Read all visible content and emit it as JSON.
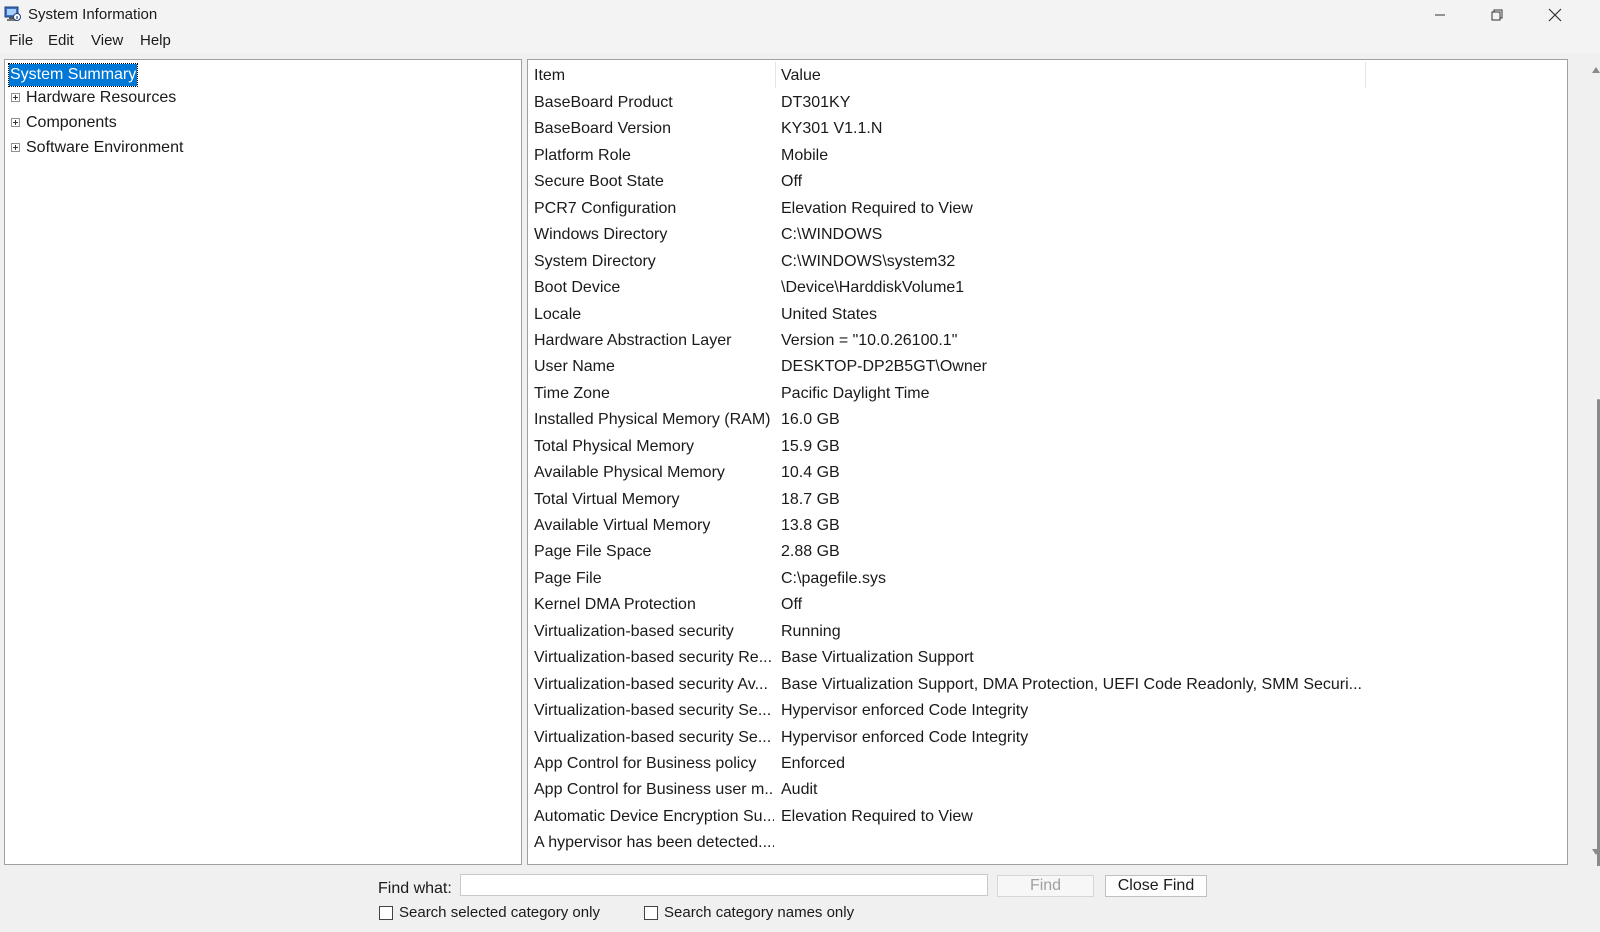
{
  "window": {
    "title": "System Information"
  },
  "menu": {
    "items": [
      "File",
      "Edit",
      "View",
      "Help"
    ]
  },
  "tree": {
    "selected": "System Summary",
    "items": [
      "Hardware Resources",
      "Components",
      "Software Environment"
    ]
  },
  "details": {
    "columns": {
      "item": "Item",
      "value": "Value"
    },
    "rows": [
      {
        "item": "BaseBoard Product",
        "value": "DT301KY"
      },
      {
        "item": "BaseBoard Version",
        "value": "KY301 V1.1.N"
      },
      {
        "item": "Platform Role",
        "value": "Mobile"
      },
      {
        "item": "Secure Boot State",
        "value": "Off"
      },
      {
        "item": "PCR7 Configuration",
        "value": "Elevation Required to View"
      },
      {
        "item": "Windows Directory",
        "value": "C:\\WINDOWS"
      },
      {
        "item": "System Directory",
        "value": "C:\\WINDOWS\\system32"
      },
      {
        "item": "Boot Device",
        "value": "\\Device\\HarddiskVolume1"
      },
      {
        "item": "Locale",
        "value": "United States"
      },
      {
        "item": "Hardware Abstraction Layer",
        "value": "Version = \"10.0.26100.1\""
      },
      {
        "item": "User Name",
        "value": "DESKTOP-DP2B5GT\\Owner"
      },
      {
        "item": "Time Zone",
        "value": "Pacific Daylight Time"
      },
      {
        "item": "Installed Physical Memory (RAM)",
        "value": "16.0 GB"
      },
      {
        "item": "Total Physical Memory",
        "value": "15.9 GB"
      },
      {
        "item": "Available Physical Memory",
        "value": "10.4 GB"
      },
      {
        "item": "Total Virtual Memory",
        "value": "18.7 GB"
      },
      {
        "item": "Available Virtual Memory",
        "value": "13.8 GB"
      },
      {
        "item": "Page File Space",
        "value": "2.88 GB"
      },
      {
        "item": "Page File",
        "value": "C:\\pagefile.sys"
      },
      {
        "item": "Kernel DMA Protection",
        "value": "Off"
      },
      {
        "item": "Virtualization-based security",
        "value": "Running"
      },
      {
        "item": "Virtualization-based security Re...",
        "value": "Base Virtualization Support"
      },
      {
        "item": "Virtualization-based security Av...",
        "value": "Base Virtualization Support, DMA Protection, UEFI Code Readonly, SMM Securi..."
      },
      {
        "item": "Virtualization-based security Se...",
        "value": "Hypervisor enforced Code Integrity"
      },
      {
        "item": "Virtualization-based security Se...",
        "value": "Hypervisor enforced Code Integrity"
      },
      {
        "item": "App Control for Business policy",
        "value": "Enforced"
      },
      {
        "item": "App Control for Business user m...",
        "value": "Audit"
      },
      {
        "item": "Automatic Device Encryption Su...",
        "value": "Elevation Required to View"
      },
      {
        "item": "A hypervisor has been detected....",
        "value": ""
      }
    ]
  },
  "find": {
    "label": "Find what:",
    "value": "",
    "find_button": "Find",
    "close_button": "Close Find",
    "option1": "Search selected category only",
    "option2": "Search category names only"
  },
  "colors": {
    "selection": "#0078d7"
  }
}
